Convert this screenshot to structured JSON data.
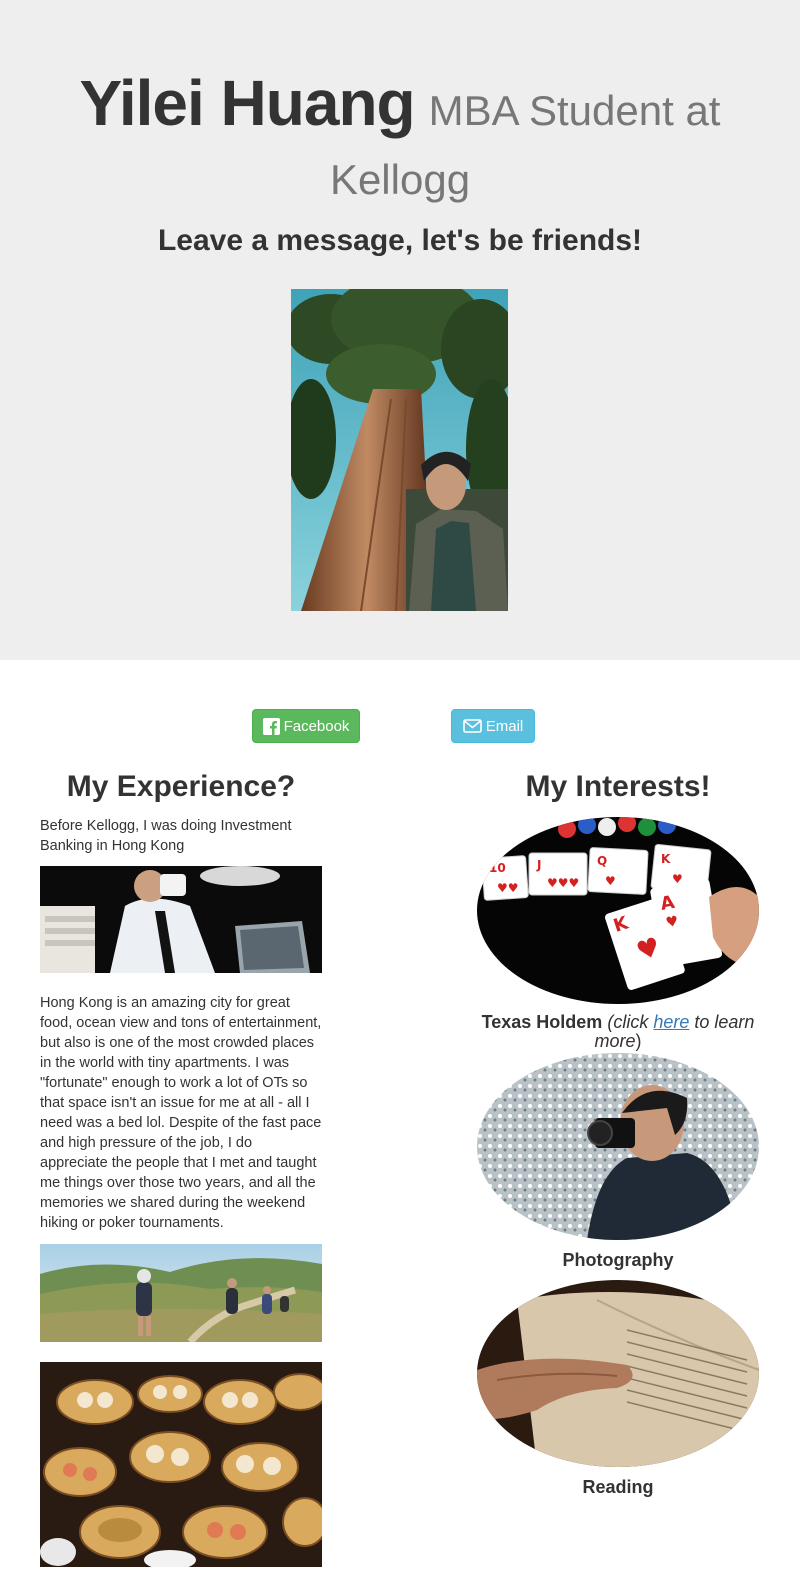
{
  "header": {
    "name": "Yilei Huang",
    "subtitle_line1": "MBA Student at",
    "subtitle_line2": "Kellogg",
    "tagline": "Leave a message, let's be friends!"
  },
  "buttons": {
    "facebook_label": "Facebook",
    "email_label": "Email",
    "facebook_icon": "facebook-icon",
    "email_icon": "envelope-icon"
  },
  "experience": {
    "heading": "My Experience?",
    "intro": "Before Kellogg, I was doing Investment Banking in Hong Kong",
    "body": "Hong Kong is an amazing city for great food, ocean view and tons of entertainment, but also is one of the most crowded places in the world with tiny apartments. I was \"fortunate\" enough to work a lot of OTs so that space isn't an issue for me at all - all I need was a bed lol. Despite of the fast pace and high pressure of the job, I do appreciate the people that I met and taught me things over those two years, and all the memories we shared during the weekend hiking or poker tournaments."
  },
  "interests": {
    "heading": "My Interests!",
    "poker_title": "Texas Holdem",
    "poker_note_before": "(click ",
    "poker_link": "here",
    "poker_note_after": " to learn more",
    "poker_close": ")",
    "photography": "Photography",
    "reading": "Reading"
  },
  "colors": {
    "jumbotron_bg": "#eeeeee",
    "facebook_btn": "#5cb85c",
    "email_btn": "#5bc0de",
    "link": "#337ab7"
  }
}
